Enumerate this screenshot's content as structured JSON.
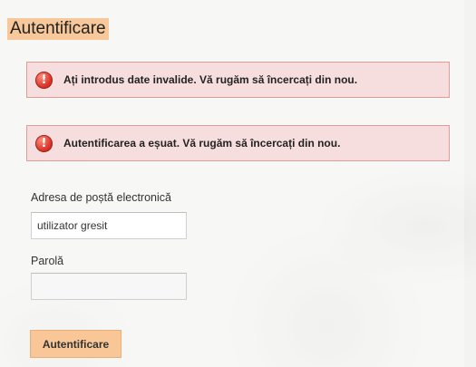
{
  "page": {
    "title": "Autentificare"
  },
  "alerts": [
    {
      "icon": "exclamation-icon",
      "symbol": "!",
      "text": "Ați introdus date invalide. Vă rugăm să încercați din nou."
    },
    {
      "icon": "exclamation-icon",
      "symbol": "!",
      "text": "Autentificarea a eșuat. Vă rugăm să încercați din nou."
    }
  ],
  "form": {
    "email_label": "Adresa de poștă electronică",
    "email_value": "utilizator gresit",
    "password_label": "Parolă",
    "password_value": "",
    "submit_label": "Autentificare"
  },
  "colors": {
    "accent": "#f9c797",
    "alert_background": "#f7dede",
    "alert_border": "#e29a9a",
    "alert_icon": "#d9352a"
  }
}
